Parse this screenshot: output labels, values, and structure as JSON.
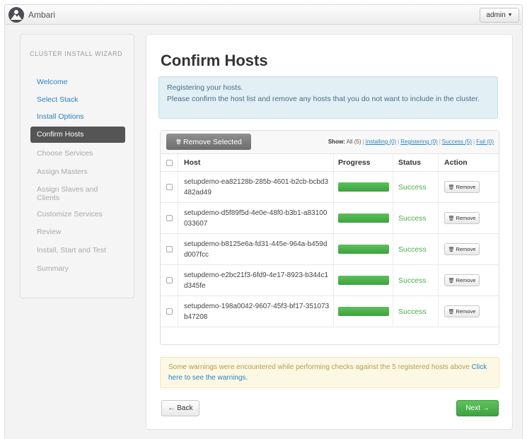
{
  "app": {
    "name": "Ambari",
    "user_menu": "admin"
  },
  "sidebar": {
    "title": "CLUSTER INSTALL WIZARD",
    "items": [
      {
        "label": "Welcome",
        "state": "done"
      },
      {
        "label": "Select Stack",
        "state": "done"
      },
      {
        "label": "Install Options",
        "state": "done"
      },
      {
        "label": "Confirm Hosts",
        "state": "active"
      },
      {
        "label": "Choose Services",
        "state": "todo"
      },
      {
        "label": "Assign Masters",
        "state": "todo"
      },
      {
        "label": "Assign Slaves and Clients",
        "state": "todo"
      },
      {
        "label": "Customize Services",
        "state": "todo"
      },
      {
        "label": "Review",
        "state": "todo"
      },
      {
        "label": "Install, Start and Test",
        "state": "todo"
      },
      {
        "label": "Summary",
        "state": "todo"
      }
    ]
  },
  "main": {
    "title": "Confirm Hosts",
    "info_line1": "Registering your hosts.",
    "info_line2": "Please confirm the host list and remove any hosts that you do not want to include in the cluster.",
    "toolbar": {
      "remove_selected": "Remove Selected",
      "show_label": "Show:",
      "filters": [
        "All (5)",
        "Installing (0)",
        "Registering (0)",
        "Success (5)",
        "Fail (0)"
      ]
    },
    "columns": {
      "host": "Host",
      "progress": "Progress",
      "status": "Status",
      "action": "Action"
    },
    "hosts": [
      {
        "name": "setupdemo-ea82128b-285b-4601-b2cb-bcbd3482ad49",
        "progress": 100,
        "status": "Success",
        "action": "Remove"
      },
      {
        "name": "setupdemo-d5f89f5d-4e0e-48f0-b3b1-a83100033607",
        "progress": 100,
        "status": "Success",
        "action": "Remove"
      },
      {
        "name": "setupdemo-b8125e6a-fd31-445e-964a-b459dd007fcc",
        "progress": 100,
        "status": "Success",
        "action": "Remove"
      },
      {
        "name": "setupdemo-e2bc21f3-6fd9-4e17-8923-b344c1d345fe",
        "progress": 100,
        "status": "Success",
        "action": "Remove"
      },
      {
        "name": "setupdemo-198a0042-9607-45f3-bf17-351073b47208",
        "progress": 100,
        "status": "Success",
        "action": "Remove"
      }
    ],
    "warning_text": "Some warnings were encountered while performing checks against the 5 registered hosts above",
    "warning_link": "Click here to see the warnings.",
    "back_label": "← Back",
    "next_label": "Next →"
  },
  "colors": {
    "accent": "#2a83c6",
    "success": "#4cae4c",
    "active_nav": "#555555",
    "warning_text": "#b99a53"
  }
}
